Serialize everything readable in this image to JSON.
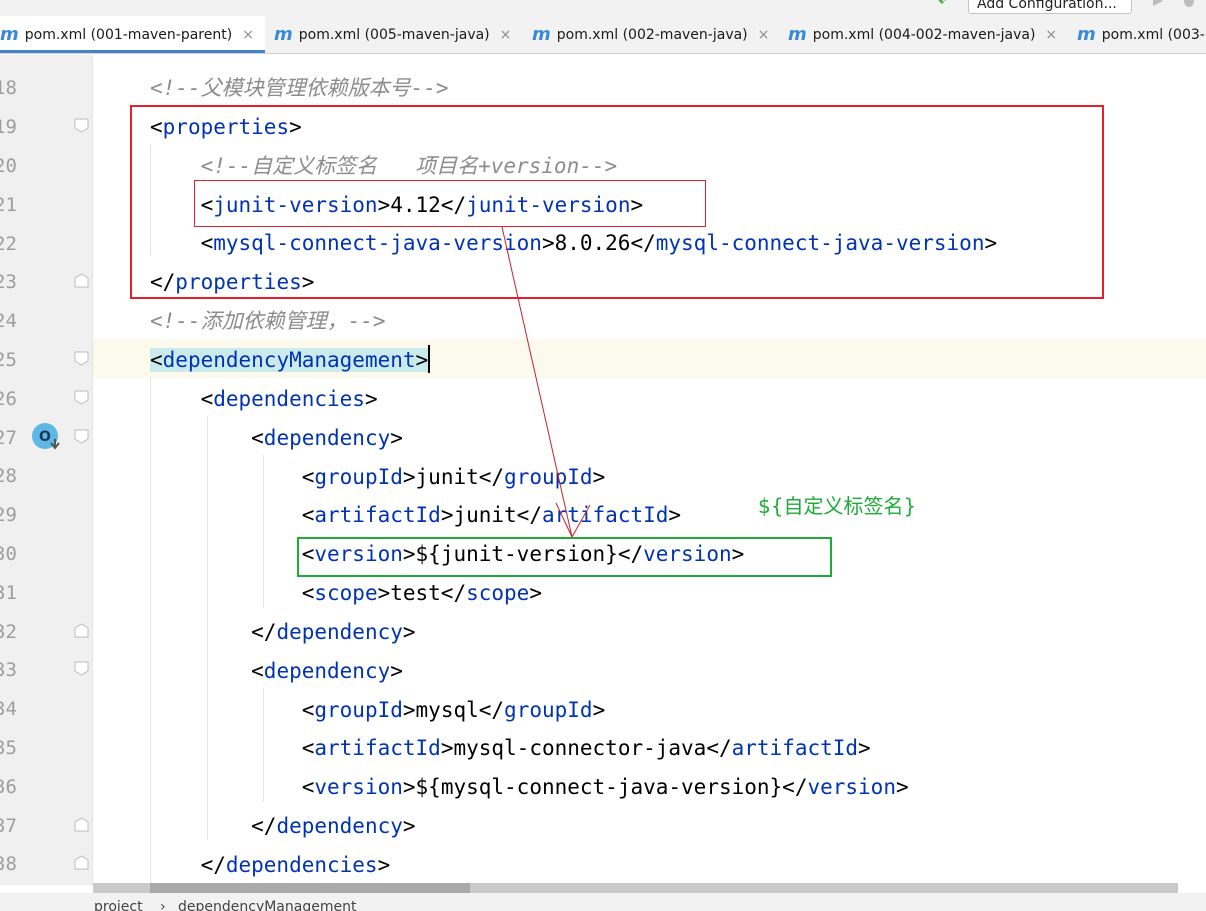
{
  "toolbar": {
    "add_configuration_label": "Add Configuration...",
    "icons": [
      "hammer-icon",
      "run-icon",
      "debug-icon"
    ]
  },
  "tabs": [
    {
      "label": "pom.xml (001-maven-parent)",
      "active": true,
      "icon": "maven-file-icon"
    },
    {
      "label": "pom.xml (005-maven-java)",
      "active": false,
      "icon": "maven-file-icon"
    },
    {
      "label": "pom.xml (002-maven-java)",
      "active": false,
      "icon": "maven-file-icon"
    },
    {
      "label": "pom.xml (004-002-maven-java)",
      "active": false,
      "icon": "maven-file-icon"
    },
    {
      "label": "pom.xml (003-",
      "active": false,
      "icon": "maven-file-icon"
    }
  ],
  "tab_icon_letter": "m",
  "tab_close_glyph": "×",
  "editor": {
    "line_numbers": [
      "18",
      "19",
      "20",
      "21",
      "22",
      "23",
      "24",
      "25",
      "26",
      "27",
      "28",
      "29",
      "30",
      "31",
      "32",
      "33",
      "34",
      "35",
      "36",
      "37",
      "38"
    ],
    "current_line": "25",
    "lines": [
      {
        "num": "18",
        "segments": [
          {
            "t": "<!--父模块管理依赖版本号-->",
            "c": "comment"
          }
        ]
      },
      {
        "num": "19",
        "segments": [
          {
            "t": "<",
            "c": ""
          },
          {
            "t": "properties",
            "c": "tag"
          },
          {
            "t": ">",
            "c": ""
          }
        ]
      },
      {
        "num": "20",
        "segments": [
          {
            "t": "    <!--自定义标签名   项目名+version-->",
            "c": "comment"
          }
        ]
      },
      {
        "num": "21",
        "segments": [
          {
            "t": "    <",
            "c": ""
          },
          {
            "t": "junit-version",
            "c": "tag"
          },
          {
            "t": ">4.12</",
            "c": ""
          },
          {
            "t": "junit-version",
            "c": "tag"
          },
          {
            "t": ">",
            "c": ""
          }
        ]
      },
      {
        "num": "22",
        "segments": [
          {
            "t": "    <",
            "c": ""
          },
          {
            "t": "mysql-connect-java-version",
            "c": "tag"
          },
          {
            "t": ">8.0.26</",
            "c": ""
          },
          {
            "t": "mysql-connect-java-version",
            "c": "tag"
          },
          {
            "t": ">",
            "c": ""
          }
        ]
      },
      {
        "num": "23",
        "segments": [
          {
            "t": "</",
            "c": ""
          },
          {
            "t": "properties",
            "c": "tag"
          },
          {
            "t": ">",
            "c": ""
          }
        ]
      },
      {
        "num": "24",
        "segments": [
          {
            "t": "<!--添加依赖管理，-->",
            "c": "comment"
          }
        ]
      },
      {
        "num": "25",
        "segments": [
          {
            "t": "<",
            "c": "hl"
          },
          {
            "t": "dependencyManagement",
            "c": "tag hl"
          },
          {
            "t": ">",
            "c": "hl"
          }
        ]
      },
      {
        "num": "26",
        "segments": [
          {
            "t": "    <",
            "c": ""
          },
          {
            "t": "dependencies",
            "c": "tag"
          },
          {
            "t": ">",
            "c": ""
          }
        ]
      },
      {
        "num": "27",
        "segments": [
          {
            "t": "        <",
            "c": ""
          },
          {
            "t": "dependency",
            "c": "tag"
          },
          {
            "t": ">",
            "c": ""
          }
        ]
      },
      {
        "num": "28",
        "segments": [
          {
            "t": "            <",
            "c": ""
          },
          {
            "t": "groupId",
            "c": "tag"
          },
          {
            "t": ">junit</",
            "c": ""
          },
          {
            "t": "groupId",
            "c": "tag"
          },
          {
            "t": ">",
            "c": ""
          }
        ]
      },
      {
        "num": "29",
        "segments": [
          {
            "t": "            <",
            "c": ""
          },
          {
            "t": "artifactId",
            "c": "tag"
          },
          {
            "t": ">junit</",
            "c": ""
          },
          {
            "t": "artifactId",
            "c": "tag"
          },
          {
            "t": ">",
            "c": ""
          }
        ]
      },
      {
        "num": "30",
        "segments": [
          {
            "t": "            <",
            "c": ""
          },
          {
            "t": "version",
            "c": "tag"
          },
          {
            "t": ">${junit-version}</",
            "c": ""
          },
          {
            "t": "version",
            "c": "tag"
          },
          {
            "t": ">",
            "c": ""
          }
        ]
      },
      {
        "num": "31",
        "segments": [
          {
            "t": "            <",
            "c": ""
          },
          {
            "t": "scope",
            "c": "tag"
          },
          {
            "t": ">test</",
            "c": ""
          },
          {
            "t": "scope",
            "c": "tag"
          },
          {
            "t": ">",
            "c": ""
          }
        ]
      },
      {
        "num": "32",
        "segments": [
          {
            "t": "        </",
            "c": ""
          },
          {
            "t": "dependency",
            "c": "tag"
          },
          {
            "t": ">",
            "c": ""
          }
        ]
      },
      {
        "num": "33",
        "segments": [
          {
            "t": "        <",
            "c": ""
          },
          {
            "t": "dependency",
            "c": "tag"
          },
          {
            "t": ">",
            "c": ""
          }
        ]
      },
      {
        "num": "34",
        "segments": [
          {
            "t": "            <",
            "c": ""
          },
          {
            "t": "groupId",
            "c": "tag"
          },
          {
            "t": ">mysql</",
            "c": ""
          },
          {
            "t": "groupId",
            "c": "tag"
          },
          {
            "t": ">",
            "c": ""
          }
        ]
      },
      {
        "num": "35",
        "segments": [
          {
            "t": "            <",
            "c": ""
          },
          {
            "t": "artifactId",
            "c": "tag"
          },
          {
            "t": ">mysql-connector-java</",
            "c": ""
          },
          {
            "t": "artifactId",
            "c": "tag"
          },
          {
            "t": ">",
            "c": ""
          }
        ]
      },
      {
        "num": "36",
        "segments": [
          {
            "t": "            <",
            "c": ""
          },
          {
            "t": "version",
            "c": "tag"
          },
          {
            "t": ">${mysql-connect-java-version}</",
            "c": ""
          },
          {
            "t": "version",
            "c": "tag"
          },
          {
            "t": ">",
            "c": ""
          }
        ]
      },
      {
        "num": "37",
        "segments": [
          {
            "t": "        </",
            "c": ""
          },
          {
            "t": "dependency",
            "c": "tag"
          },
          {
            "t": ">",
            "c": ""
          }
        ]
      },
      {
        "num": "38",
        "segments": [
          {
            "t": "    </",
            "c": ""
          },
          {
            "t": "dependencies",
            "c": "tag"
          },
          {
            "t": ">",
            "c": ""
          }
        ]
      }
    ]
  },
  "annotation": {
    "text": "${自定义标签名}",
    "box_colors": {
      "red": "#e3202b",
      "green": "#1fab39"
    }
  },
  "breadcrumb": [
    "project",
    "dependencyManagement"
  ],
  "breadcrumb_separator": "›",
  "colors": {
    "tag": "#0033b3",
    "comment": "#8c8c8c",
    "tab_accent": "#4083c9",
    "maven_icon": "#3a8ad8",
    "tag_highlight": "#cbeaec"
  }
}
